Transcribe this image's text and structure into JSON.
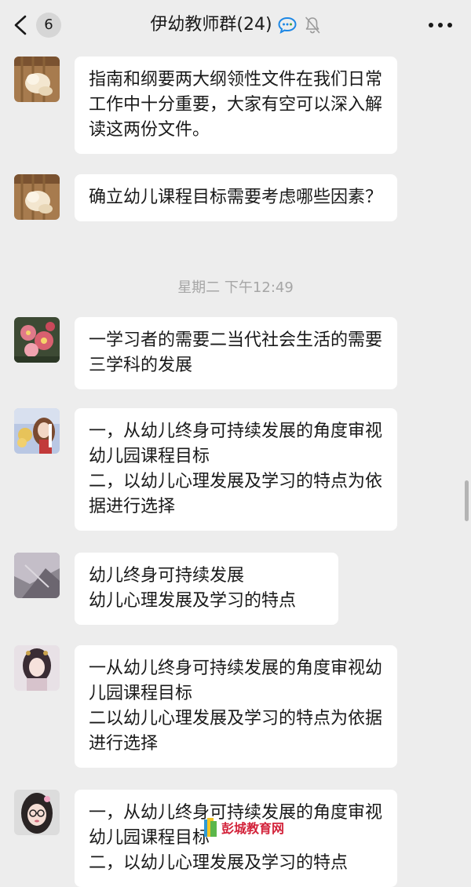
{
  "header": {
    "back_count": "6",
    "title": "伊幼教师群(24)",
    "icons": [
      "chevron-left-icon",
      "chat-bubble-icon",
      "bell-muted-icon",
      "more-dots-icon"
    ]
  },
  "messages": [
    {
      "avatar": "avatar-cat-photo",
      "text": "指南和纲要两大纲领性文件在我们日常工作中十分重要，大家有空可以深入解读这两份文件。"
    },
    {
      "avatar": "avatar-cat-photo",
      "text": "确立幼儿课程目标需要考虑哪些因素？"
    },
    {
      "avatar": "avatar-flower-photo",
      "text": "一学习者的需要二当代社会生活的需要三学科的发展"
    },
    {
      "avatar": "avatar-anime-girl",
      "text": "一，从幼儿终身可持续发展的角度审视幼儿园课程目标\n二，以幼儿心理发展及学习的特点为依据进行选择"
    },
    {
      "avatar": "avatar-gray-photo",
      "text": "幼儿终身可持续发展\n幼儿心理发展及学习的特点"
    },
    {
      "avatar": "avatar-ancient-girl",
      "text": "一从幼儿终身可持续发展的角度审视幼儿园课程目标\n二以幼儿心理发展及学习的特点为依据进行选择"
    },
    {
      "avatar": "avatar-girl-glasses",
      "text": "一，从幼儿终身可持续发展的角度审视幼儿园课程目标\n二，以幼儿心理发展及学习的特点"
    }
  ],
  "timestamp": "星期二 下午12:49",
  "watermark": "彭城教育网",
  "colors": {
    "background": "#ededed",
    "bubble": "#ffffff",
    "text": "#191919",
    "timestamp": "#a6a6a6",
    "chat_icon_accent": "#1e88e5"
  }
}
